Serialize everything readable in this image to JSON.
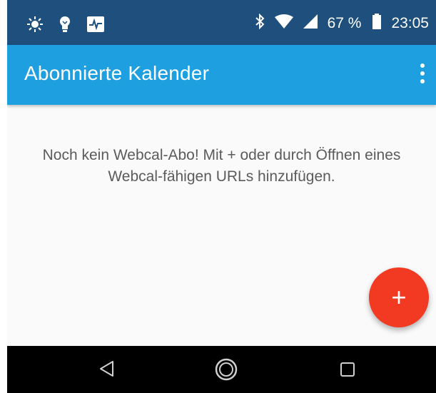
{
  "status_bar": {
    "icons_left": [
      "brightness-icon",
      "lightbulb-icon",
      "activity-monitor-icon"
    ],
    "icons_right": [
      "bluetooth-icon",
      "wifi-icon",
      "cell-signal-icon",
      "battery-icon"
    ],
    "battery": "67 %",
    "time": "23:05",
    "background_color": "#1e4f7d"
  },
  "app_bar": {
    "title": "Abonnierte Kalender",
    "background_color": "#1e9fe0",
    "menu_icon": "more-vert-icon"
  },
  "main": {
    "empty_message_line1": "Noch kein Webcal-Abo! Mit + oder durch Öffnen eines",
    "empty_message_line2": "Webcal-fähigen URLs hinzufügen."
  },
  "fab": {
    "label": "+",
    "color": "#f23a23"
  },
  "nav_bar": {
    "buttons": [
      "back-icon",
      "home-icon",
      "recents-icon"
    ]
  }
}
